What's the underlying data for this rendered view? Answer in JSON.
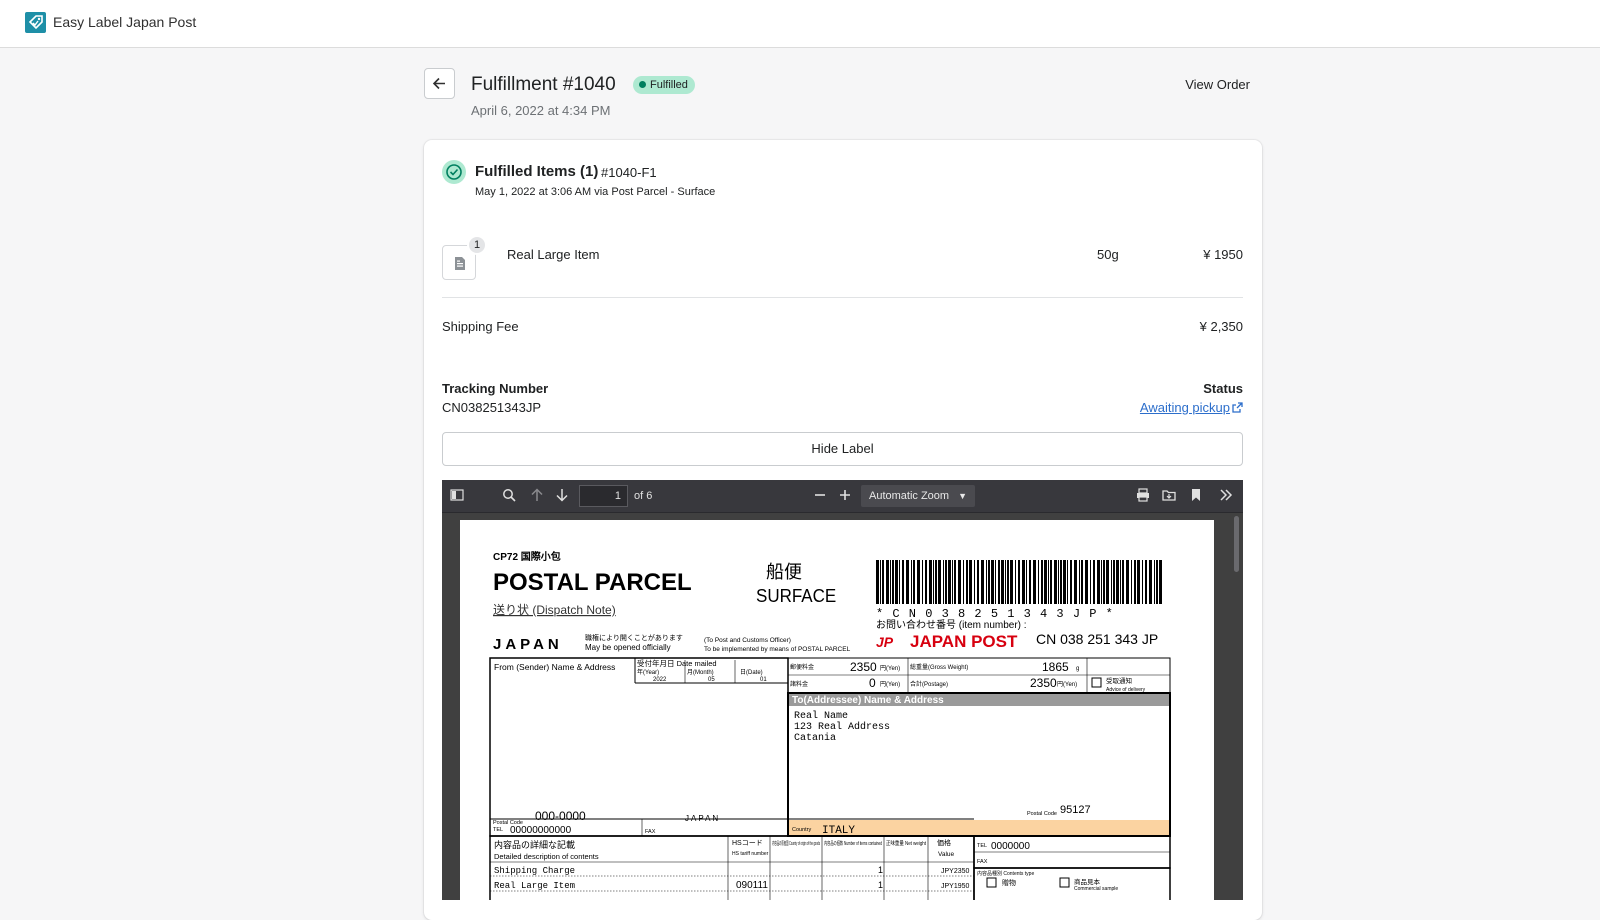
{
  "app": {
    "name": "Easy Label Japan Post"
  },
  "header": {
    "title": "Fulfillment #1040",
    "badge": "Fulfilled",
    "date": "April 6, 2022 at 4:34 PM",
    "view_order": "View Order"
  },
  "fulfillment": {
    "title": "Fulfilled Items (1)",
    "id": "#1040-F1",
    "subtitle": "May 1, 2022 at 3:06 AM via Post Parcel - Surface"
  },
  "item": {
    "quantity": "1",
    "name": "Real Large Item",
    "weight": "50g",
    "price": "¥ 1950"
  },
  "shipping_fee": {
    "label": "Shipping Fee",
    "value": "¥ 2,350"
  },
  "tracking": {
    "label": "Tracking Number",
    "number": "CN038251343JP",
    "status_label": "Status",
    "status": "Awaiting pickup"
  },
  "hide_label_button": "Hide Label",
  "pdf_viewer": {
    "page": "1",
    "of_pages": "of 6",
    "zoom": "Automatic Zoom"
  },
  "label": {
    "code": "CP72 国際小包",
    "title": "POSTAL PARCEL",
    "dispatch": "送り状 (Dispatch Note)",
    "origin": "JAPAN",
    "opened_jp": "職権により開くことがあります",
    "opened_en": "May be opened officially",
    "officer": "(To Post and Customs Officer)",
    "implemented": "To be implemented by means of POSTAL PARCEL",
    "method_jp": "船便",
    "method_en": "SURFACE",
    "barcode_text": "* C N 0 3 8 2 5 1 3 4 3 J P *",
    "inquiry": "お問い合わせ番号 (item number) :",
    "japan_post": "JAPAN POST",
    "item_number": "CN 038 251 343 JP",
    "from_label": "From (Sender) Name & Address",
    "accept_date_label": "受付年月日 Date mailed",
    "year_label": "年(Year)",
    "month_label": "月(Month)",
    "day_label": "日(Date)",
    "year": "2022",
    "month": "05",
    "day": "01",
    "insurance_label": "郵便料金",
    "insurance_val": "2350",
    "fee_label": "諸料金",
    "fee_val": "0",
    "yen": "円(Yen)",
    "gross_label": "総重量(Gross Weight)",
    "gross_val": "1865",
    "gross_unit": "g",
    "postage_label": "合計(Postage)",
    "postage_val": "2350",
    "notice_jp": "受取通知",
    "notice_en": "Advice of delivery",
    "to_label": "To(Addressee) Name & Address",
    "to_lines": [
      "Real Name",
      "123 Real Address",
      "Catania"
    ],
    "from_postal_label": "Postal Code",
    "from_postal": "000-0000",
    "from_country": "JAPAN",
    "to_postal_label": "Postal Code",
    "to_postal": "95127",
    "country_label": "Country",
    "to_country": "ITALY",
    "tel_label": "TEL",
    "from_tel": "00000000000",
    "fax_label": "FAX",
    "to_tel": "0000000",
    "contents_jp": "内容品の詳細な記載",
    "contents_en": "Detailed description of contents",
    "hs_label": "HSコード",
    "hs_en": "HS tariff number",
    "origin_col": "内容品の原産国 Country of origin of the goods",
    "num_col": "内容品の個数 Number of items contained",
    "net_col": "正味重量 Net weight",
    "value_jp": "価格",
    "value_en": "Value",
    "rows": [
      {
        "desc": "Shipping Charge",
        "hs": "",
        "count": "1",
        "value": "JPY2350"
      },
      {
        "desc": "Real Large Item",
        "hs": "090111",
        "count": "1",
        "value": "JPY1950"
      }
    ],
    "contents_type": "内容品種別 Contents type",
    "gift": "贈物",
    "sample_jp": "商品見本",
    "sample_en": "Commercial sample"
  },
  "colors": {
    "badge_bg": "#aee9d1",
    "badge_dot": "#007f5f",
    "link": "#2c6ecb",
    "japan_post_red": "#d7000f",
    "country_highlight": "#fbd3a1"
  }
}
